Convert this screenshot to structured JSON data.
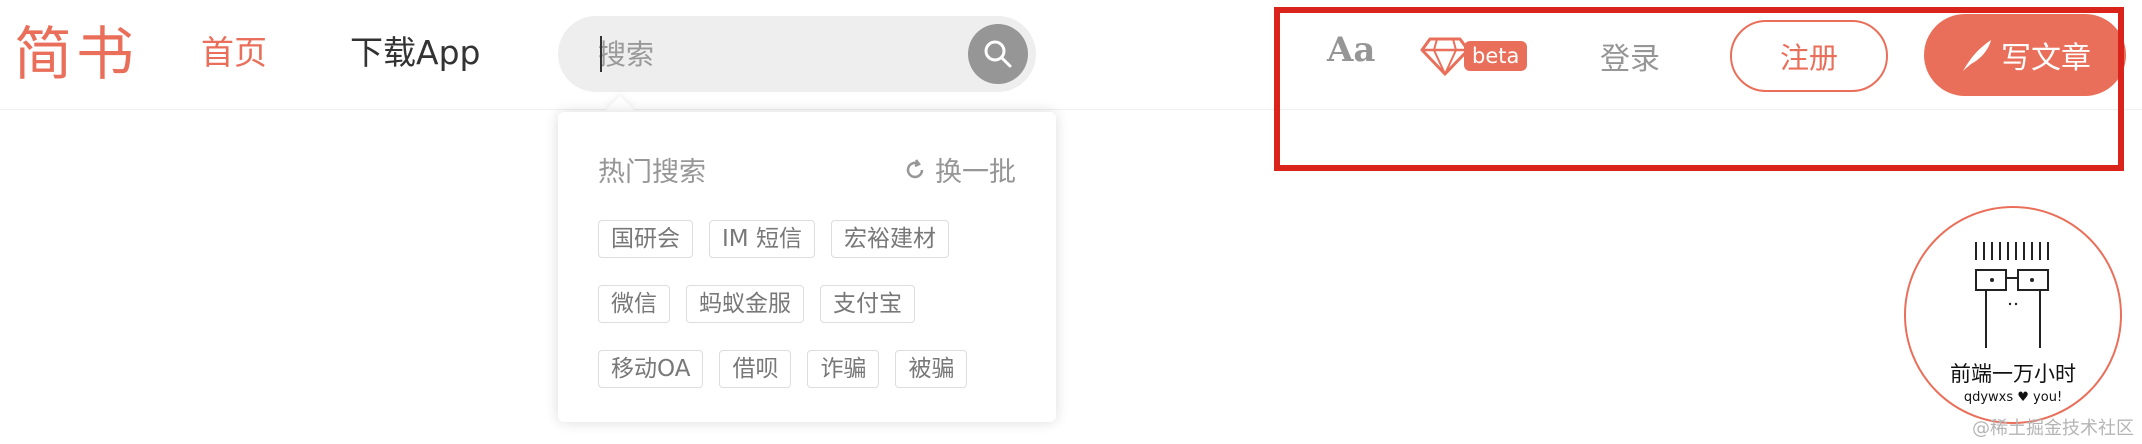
{
  "logo": {
    "text": "简书"
  },
  "nav": {
    "home": "首页",
    "download": "下载App"
  },
  "search": {
    "placeholder": "搜索",
    "icon": "search-icon"
  },
  "dropdown": {
    "title": "热门搜索",
    "refresh_label": "换一批",
    "tag_rows": [
      [
        "国研会",
        "IM 短信",
        "宏裕建材"
      ],
      [
        "微信",
        "蚂蚁金服",
        "支付宝"
      ],
      [
        "移动OA",
        "借呗",
        "诈骗",
        "被骗"
      ]
    ]
  },
  "toolbar": {
    "font_toggle": "Aa",
    "beta_label": "beta",
    "login": "登录",
    "register": "注册",
    "write": "写文章"
  },
  "avatar": {
    "name": "前端一万小时",
    "subtitle": "qdywxs ♥ you!"
  },
  "watermark": "@稀土掘金技术社区",
  "colors": {
    "brand": "#ea6f5a",
    "highlight_box": "#d9231b",
    "search_bg": "#eeeeee",
    "muted": "#969696"
  }
}
